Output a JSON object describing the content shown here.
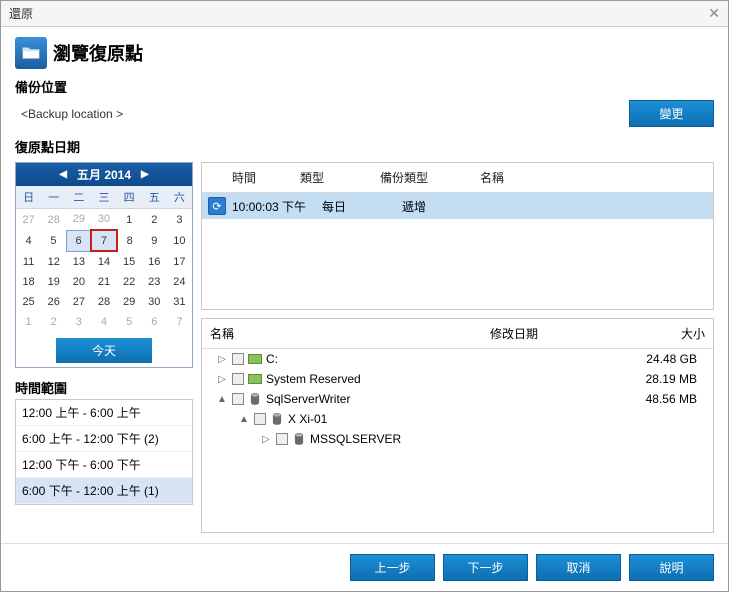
{
  "window": {
    "title": "還原"
  },
  "page": {
    "title": "瀏覽復原點"
  },
  "backup": {
    "section_label": "備份位置",
    "location_text": "<Backup location >",
    "change_btn": "變更"
  },
  "dates_label": "復原點日期",
  "calendar": {
    "month_label": "五月 2014",
    "dow": [
      "日",
      "一",
      "二",
      "三",
      "四",
      "五",
      "六"
    ],
    "weeks": [
      [
        {
          "d": "27",
          "o": 1
        },
        {
          "d": "28",
          "o": 1
        },
        {
          "d": "29",
          "o": 1
        },
        {
          "d": "30",
          "o": 1
        },
        {
          "d": "1"
        },
        {
          "d": "2"
        },
        {
          "d": "3"
        }
      ],
      [
        {
          "d": "4"
        },
        {
          "d": "5"
        },
        {
          "d": "6",
          "hl": 1
        },
        {
          "d": "7",
          "sel": 1
        },
        {
          "d": "8"
        },
        {
          "d": "9"
        },
        {
          "d": "10"
        }
      ],
      [
        {
          "d": "11"
        },
        {
          "d": "12"
        },
        {
          "d": "13"
        },
        {
          "d": "14"
        },
        {
          "d": "15"
        },
        {
          "d": "16"
        },
        {
          "d": "17"
        }
      ],
      [
        {
          "d": "18"
        },
        {
          "d": "19"
        },
        {
          "d": "20"
        },
        {
          "d": "21"
        },
        {
          "d": "22"
        },
        {
          "d": "23"
        },
        {
          "d": "24"
        }
      ],
      [
        {
          "d": "25"
        },
        {
          "d": "26"
        },
        {
          "d": "27"
        },
        {
          "d": "28"
        },
        {
          "d": "29"
        },
        {
          "d": "30"
        },
        {
          "d": "31"
        }
      ],
      [
        {
          "d": "1",
          "o": 1
        },
        {
          "d": "2",
          "o": 1
        },
        {
          "d": "3",
          "o": 1
        },
        {
          "d": "4",
          "o": 1
        },
        {
          "d": "5",
          "o": 1
        },
        {
          "d": "6",
          "o": 1
        },
        {
          "d": "7",
          "o": 1
        }
      ]
    ],
    "today_btn": "今天"
  },
  "time_range": {
    "label": "時間範圍",
    "items": [
      {
        "text": "12:00 上午 - 6:00 上午",
        "sel": false
      },
      {
        "text": "6:00 上午 - 12:00 下午  (2)",
        "sel": false
      },
      {
        "text": "12:00 下午 - 6:00 下午",
        "sel": false
      },
      {
        "text": "6:00 下午 - 12:00 上午  (1)",
        "sel": true
      }
    ]
  },
  "recpoints": {
    "headers": {
      "time": "時間",
      "type": "類型",
      "btype": "備份類型",
      "name": "名稱"
    },
    "rows": [
      {
        "time": "10:00:03 下午",
        "type": "每日",
        "btype": "遞增",
        "name": "",
        "sel": true
      }
    ]
  },
  "tree": {
    "headers": {
      "name": "名稱",
      "date": "修改日期",
      "size": "大小"
    },
    "nodes": [
      {
        "indent": 0,
        "exp": "▷",
        "icon": "disk",
        "label": "C:",
        "size": "24.48 GB"
      },
      {
        "indent": 0,
        "exp": "▷",
        "icon": "disk",
        "label": "System Reserved",
        "size": "28.19 MB"
      },
      {
        "indent": 0,
        "exp": "▲",
        "icon": "sql",
        "label": "SqlServerWriter",
        "size": "48.56 MB"
      },
      {
        "indent": 1,
        "exp": "▲",
        "icon": "sql",
        "label": "X Xi-01",
        "size": ""
      },
      {
        "indent": 2,
        "exp": "▷",
        "icon": "sql",
        "label": "MSSQLSERVER",
        "size": ""
      }
    ]
  },
  "footer": {
    "prev": "上一步",
    "next": "下一步",
    "cancel": "取消",
    "help": "說明"
  }
}
